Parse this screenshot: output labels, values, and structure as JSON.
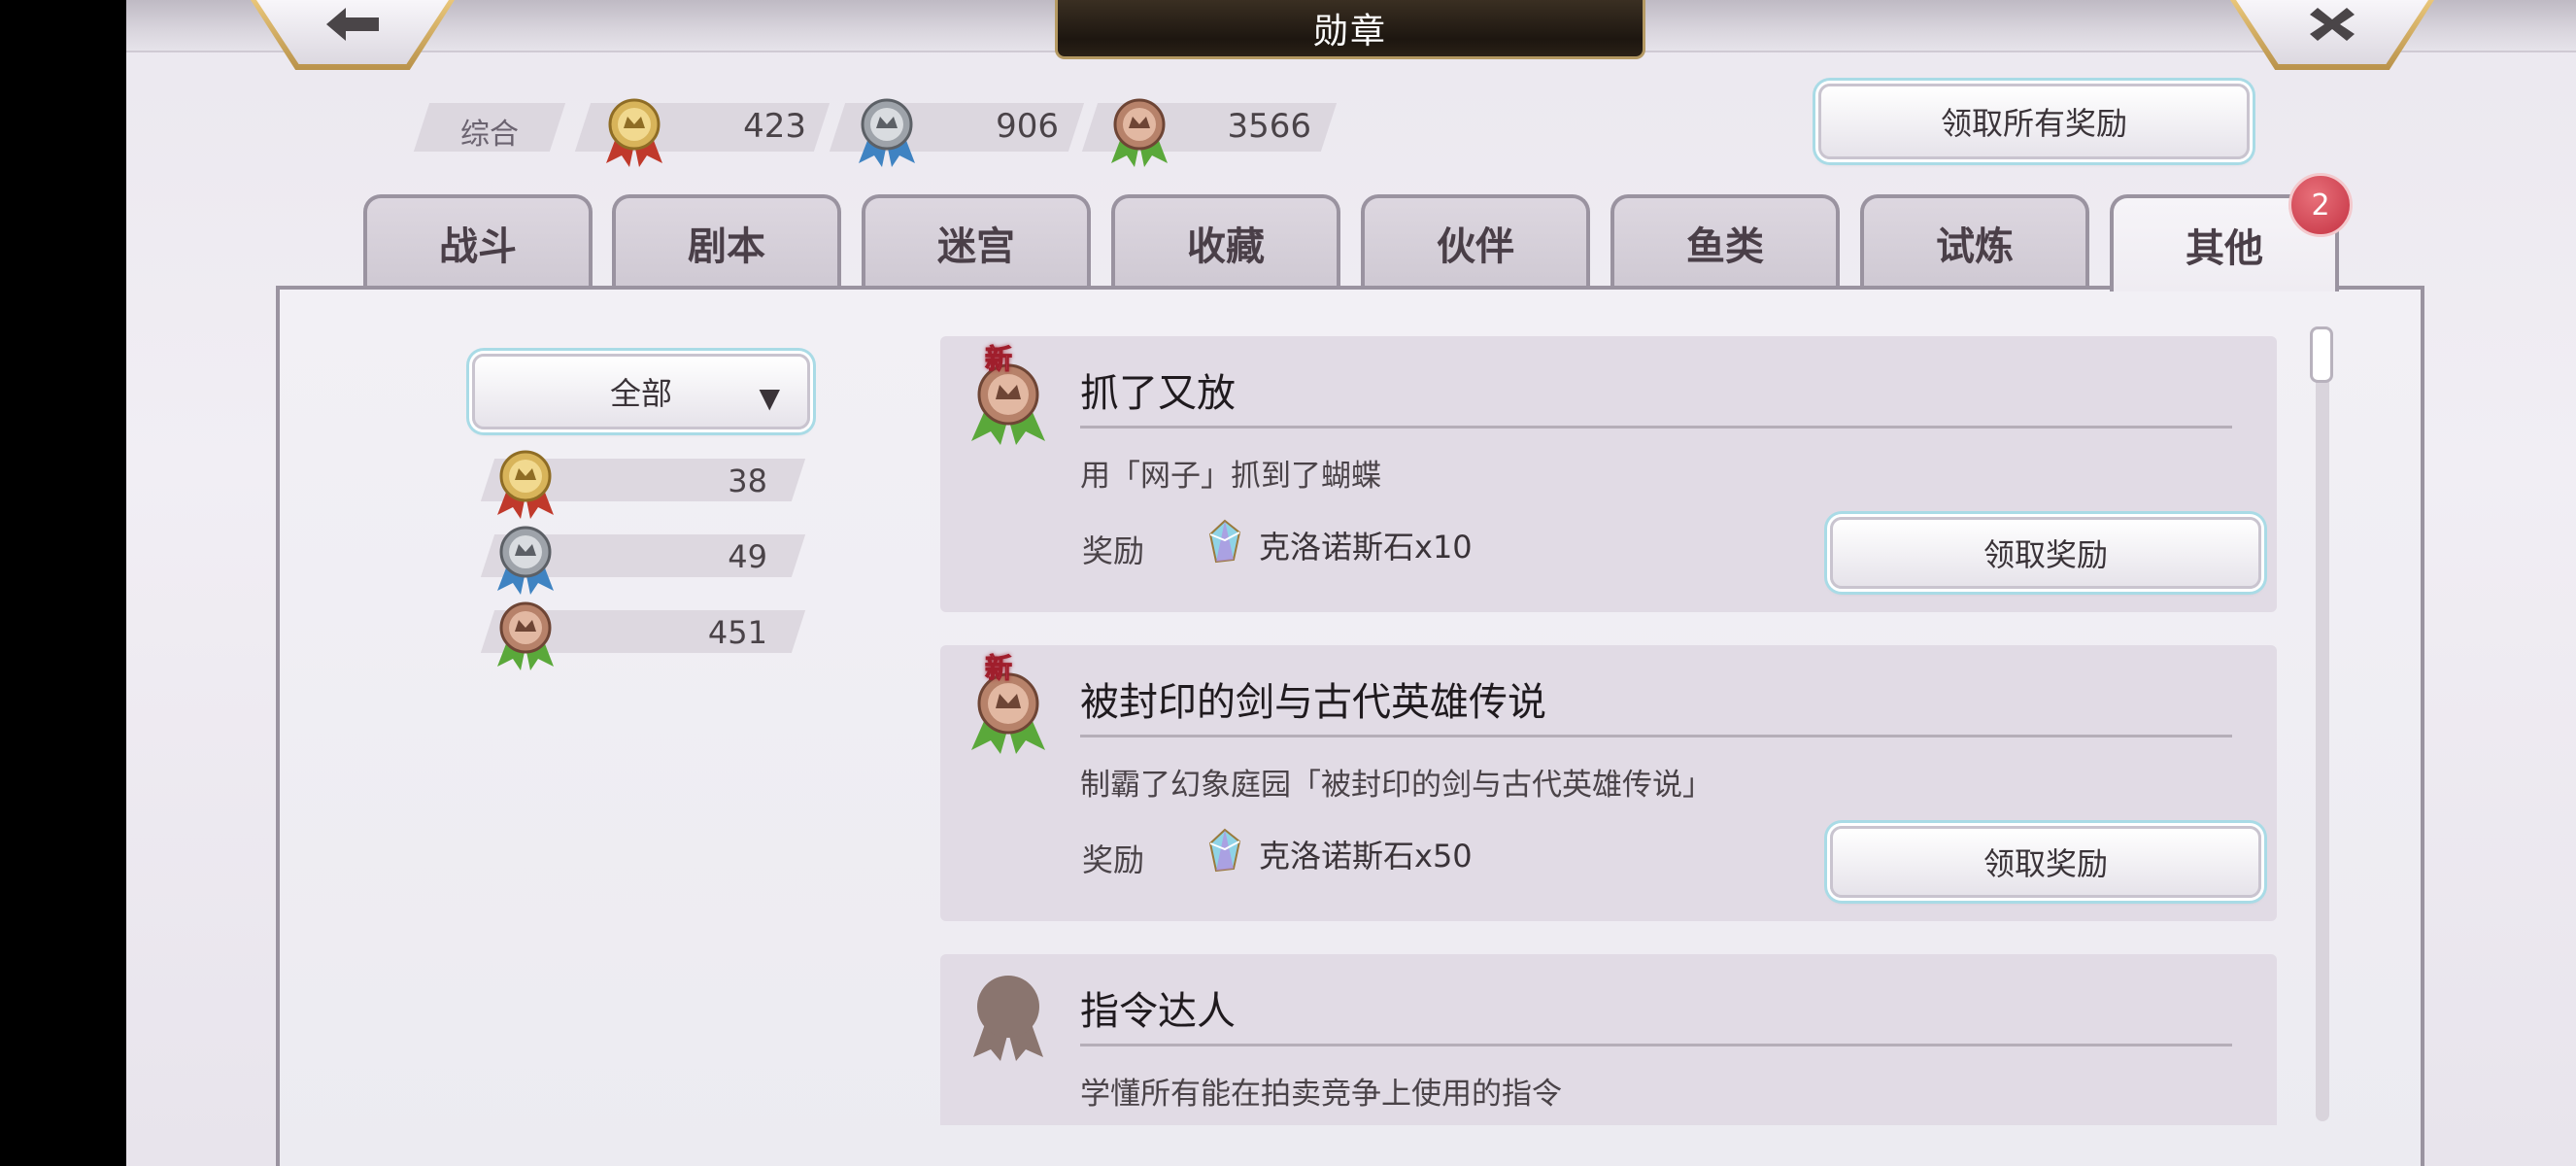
{
  "header": {
    "title": "勋章",
    "back_icon": "back-arrow-icon",
    "close_icon": "close-icon"
  },
  "summary": {
    "label": "综合",
    "gold": "423",
    "silver": "906",
    "bronze": "3566",
    "claim_all_label": "领取所有奖励"
  },
  "tabs": [
    {
      "label": "战斗"
    },
    {
      "label": "剧本"
    },
    {
      "label": "迷宫"
    },
    {
      "label": "收藏"
    },
    {
      "label": "伙伴"
    },
    {
      "label": "鱼类"
    },
    {
      "label": "试炼"
    },
    {
      "label": "其他",
      "active": true,
      "badge": "2"
    }
  ],
  "filter": {
    "selected": "全部",
    "counts": {
      "gold": "38",
      "silver": "49",
      "bronze": "451"
    }
  },
  "achievements": [
    {
      "title": "抓了又放",
      "description": "用「网子」抓到了蝴蝶",
      "new_tag": "新",
      "reward_label": "奖励",
      "reward": "克洛诺斯石x10",
      "claim_label": "领取奖励"
    },
    {
      "title": "被封印的剑与古代英雄传说",
      "description": "制霸了幻象庭园「被封印的剑与古代英雄传说」",
      "new_tag": "新",
      "reward_label": "奖励",
      "reward": "克洛诺斯石x50",
      "claim_label": "领取奖励"
    },
    {
      "title": "指令达人",
      "description": "学懂所有能在拍卖竞争上使用的指令"
    }
  ],
  "colors": {
    "gold_ribbon": "#c0392b",
    "silver_ribbon": "#3f83c2",
    "bronze_ribbon": "#5aa83a",
    "badge": "#c43242"
  }
}
